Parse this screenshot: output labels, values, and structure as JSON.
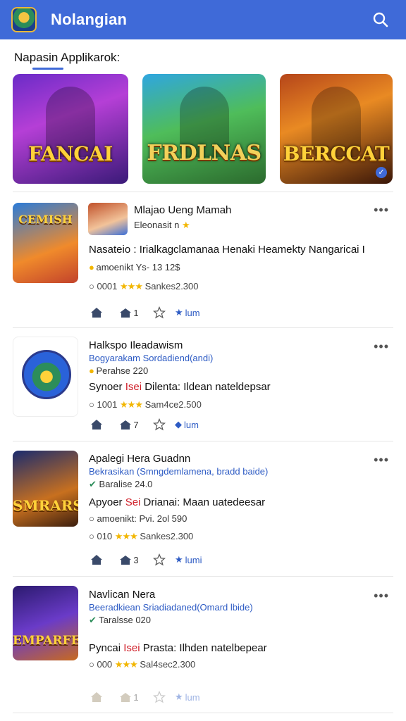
{
  "app": {
    "title": "Nolangian",
    "accent": "#3f6ad8"
  },
  "section": {
    "title": "Napasin Applikarok:"
  },
  "banners": [
    {
      "title": "FANCAI"
    },
    {
      "title": "FRDLNAS"
    },
    {
      "title": "BERCCAT"
    }
  ],
  "cards": [
    {
      "title": "Mlajao Ueng  Mamah",
      "subtitle": "Eleonasit n",
      "description_pre": "Nasateio : Irialkagclamanaa Henaki Heamekty Nangaricai I",
      "description_tag": "",
      "description_post": "",
      "meta": "amoenikt Ys- 13 12$",
      "stats_left": "0001",
      "stats_right": "Sankes2.300",
      "share_label": "1",
      "fav_label": "lum",
      "thumb_label": "CEMISH"
    },
    {
      "title": "Halkspo Ileadawism",
      "subtitle": "Bogyarakam  Sordadiend(andi)",
      "meta": "Perahse  220",
      "description_pre": "Synoer ",
      "description_tag": "Isei",
      "description_post": " Dilenta: Ildean nateldepsar",
      "stats_left": "1001",
      "stats_right": "Sam4ce2.500",
      "share_label": "7",
      "fav_label": "lum",
      "thumb_label": ""
    },
    {
      "title": "Apalegi  Hera Guadnn",
      "subtitle": "Bekrasikan (Smngdemlamena, bradd baide)",
      "meta": "Baralise  24.0",
      "description_pre": "Apyoer ",
      "description_tag": "Sei",
      "description_post": " Drianai: Maan uatedeesar",
      "meta2": "amoenikt: Pvi. 2ol 590",
      "stats_left": "010",
      "stats_right": "Sankes2.300",
      "share_label": "3",
      "fav_label": "lumi",
      "thumb_label": "SMRARS"
    },
    {
      "title": "Navlican  Nera",
      "subtitle": "Beeradkiean Sriadiadaned(Omard lbide)",
      "meta": "Taralsse  020",
      "description_pre": "Pyncai ",
      "description_tag": "Isei",
      "description_post": " Prasta: Ilhden natelbepear",
      "stats_left": "000",
      "stats_right": "Sal4sec2.300",
      "share_label": "1",
      "fav_label": "lum",
      "thumb_label": "EMPARFE"
    }
  ]
}
